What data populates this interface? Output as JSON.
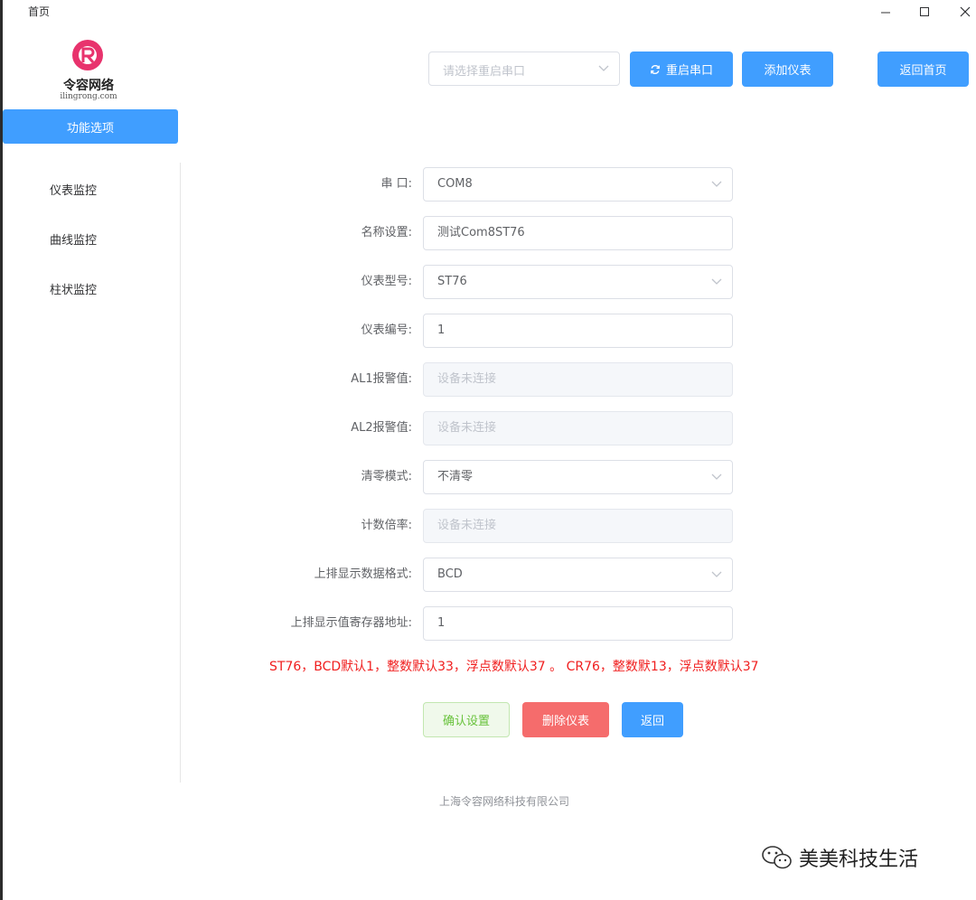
{
  "window": {
    "title": "首页"
  },
  "logo": {
    "name": "令容网络",
    "domain": "ilingrong.com"
  },
  "sidebar": {
    "header": "功能选项",
    "items": [
      {
        "label": "仪表监控"
      },
      {
        "label": "曲线监控"
      },
      {
        "label": "柱状监控"
      }
    ]
  },
  "toolbar": {
    "port_select_placeholder": "请选择重启串口",
    "restart_label": "重启串口",
    "add_label": "添加仪表",
    "home_label": "返回首页"
  },
  "form": {
    "fields": [
      {
        "label": "串 口:",
        "value": "COM8",
        "kind": "select"
      },
      {
        "label": "名称设置:",
        "value": "测试Com8ST76",
        "kind": "input"
      },
      {
        "label": "仪表型号:",
        "value": "ST76",
        "kind": "select"
      },
      {
        "label": "仪表编号:",
        "value": "1",
        "kind": "input"
      },
      {
        "label": "AL1报警值:",
        "value": "设备未连接",
        "kind": "disabled"
      },
      {
        "label": "AL2报警值:",
        "value": "设备未连接",
        "kind": "disabled"
      },
      {
        "label": "清零模式:",
        "value": "不清零",
        "kind": "select"
      },
      {
        "label": "计数倍率:",
        "value": "设备未连接",
        "kind": "disabled"
      },
      {
        "label": "上排显示数据格式:",
        "value": "BCD",
        "kind": "select"
      },
      {
        "label": "上排显示值寄存器地址:",
        "value": "1",
        "kind": "input"
      }
    ],
    "hint": "ST76，BCD默认1，整数默认33，浮点数默认37 。 CR76，整数默13，浮点数默认37",
    "confirm_label": "确认设置",
    "delete_label": "删除仪表",
    "back_label": "返回"
  },
  "footer": {
    "company": "上海令容网络科技有限公司"
  },
  "watermark": {
    "text": "美美科技生活"
  },
  "colors": {
    "primary": "#409eff",
    "danger": "#f56c6c",
    "success": "#67c23a",
    "hint": "#f01e1e"
  }
}
